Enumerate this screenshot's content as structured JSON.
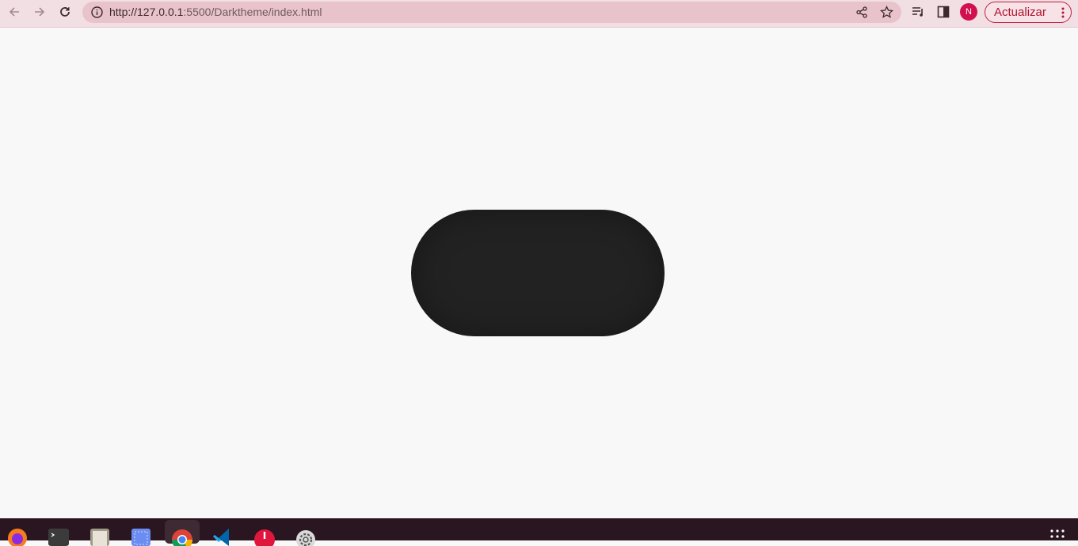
{
  "browser": {
    "url_host": "http://127.0.0.1",
    "url_rest": ":5500/Darktheme/index.html",
    "avatar_initial": "N",
    "update_label": "Actualizar",
    "colors": {
      "toolbar": "#f2dfe4",
      "omnibox": "#e9c3cc",
      "accent": "#c01f40",
      "avatar": "#d2104e"
    }
  },
  "page": {
    "background": "#f8f8f8",
    "toggle_color": "#222222"
  },
  "taskbar": {
    "apps": [
      "firefox-icon",
      "terminal-icon",
      "files-icon",
      "screenshot-icon",
      "chrome-icon",
      "vscode-icon",
      "updates-icon",
      "settings-icon"
    ],
    "active_app": "chrome-icon",
    "background": "#2a1620"
  }
}
